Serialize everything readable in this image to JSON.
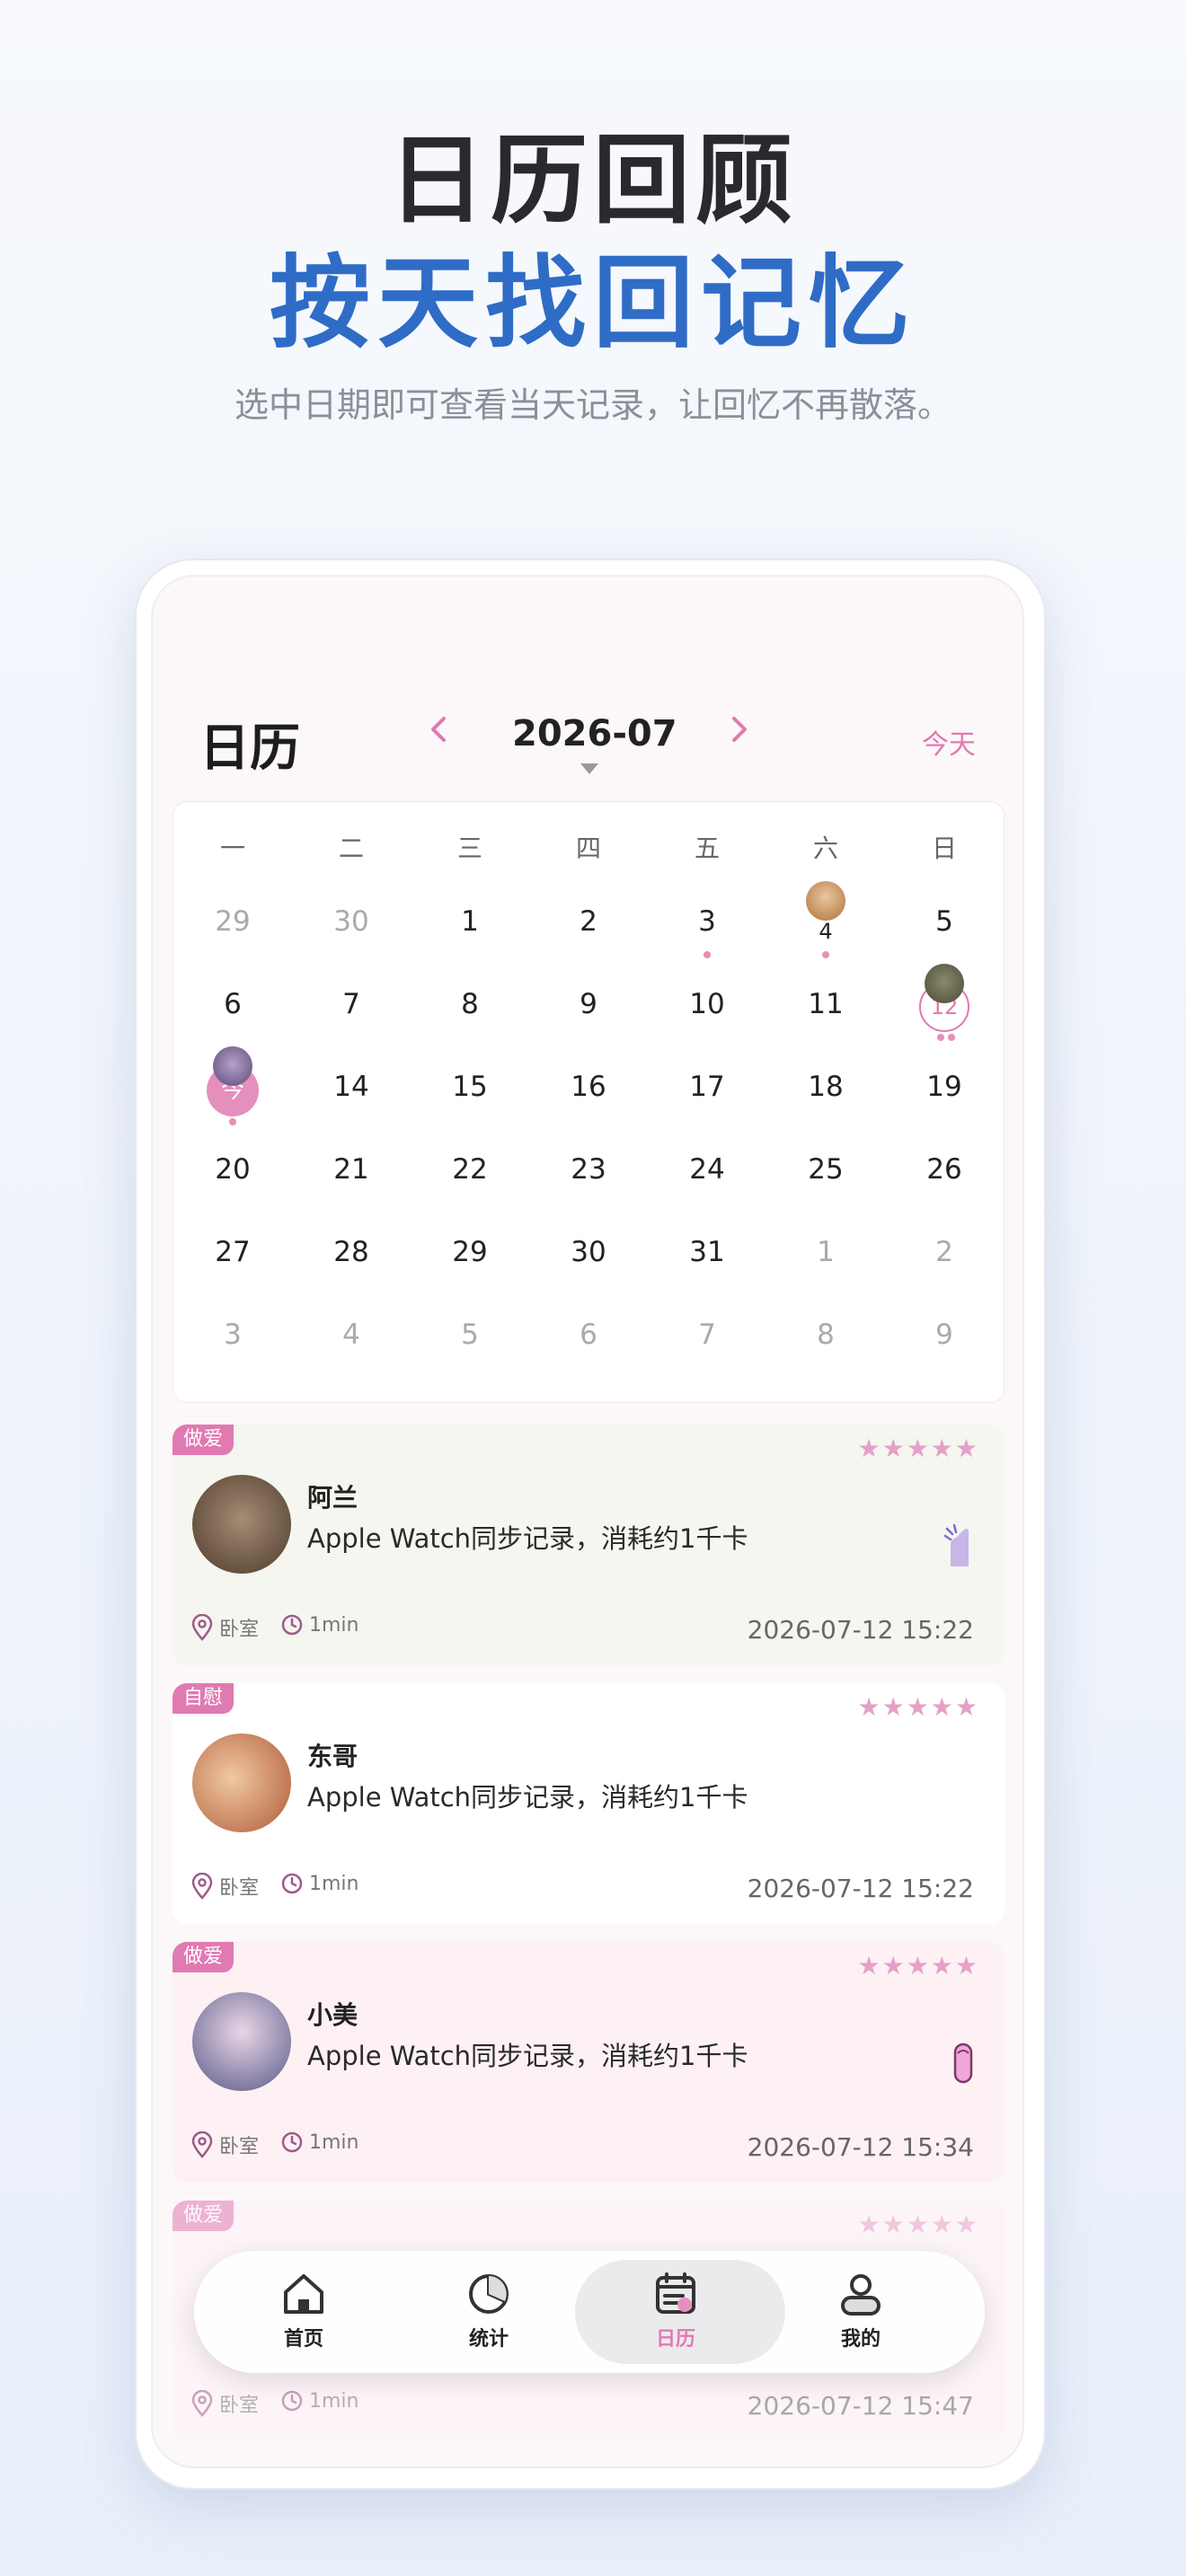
{
  "hero": {
    "title": "日历回顾",
    "subtitle_blue": "按天找回记忆",
    "caption": "选中日期即可查看当天记录，让回忆不再散落。"
  },
  "header": {
    "title": "日历",
    "month": "2026-07",
    "today_button": "今天"
  },
  "weekdays": [
    "一",
    "二",
    "三",
    "四",
    "五",
    "六",
    "日"
  ],
  "calendar": {
    "rows": [
      [
        "29",
        "30",
        "1",
        "2",
        "3",
        "4",
        "5"
      ],
      [
        "6",
        "7",
        "8",
        "9",
        "10",
        "11",
        "12"
      ],
      [
        "今",
        "14",
        "15",
        "16",
        "17",
        "18",
        "19"
      ],
      [
        "20",
        "21",
        "22",
        "23",
        "24",
        "25",
        "26"
      ],
      [
        "27",
        "28",
        "29",
        "30",
        "31",
        "1",
        "2"
      ],
      [
        "3",
        "4",
        "5",
        "6",
        "7",
        "8",
        "9"
      ]
    ]
  },
  "records": [
    {
      "tag": "做爱",
      "name": "阿兰",
      "desc": "Apple Watch同步记录，消耗约1千卡",
      "location": "卧室",
      "duration": "1min",
      "time": "2026-07-12 15:22",
      "stars": "★★★★★"
    },
    {
      "tag": "自慰",
      "name": "东哥",
      "desc": "Apple Watch同步记录，消耗约1千卡",
      "location": "卧室",
      "duration": "1min",
      "time": "2026-07-12 15:22",
      "stars": "★★★★★"
    },
    {
      "tag": "做爱",
      "name": "小美",
      "desc": "Apple Watch同步记录，消耗约1千卡",
      "location": "卧室",
      "duration": "1min",
      "time": "2026-07-12 15:34",
      "stars": "★★★★★"
    },
    {
      "tag": "做爱",
      "name": "",
      "desc": "",
      "location": "卧室",
      "duration": "1min",
      "time": "2026-07-12 15:47",
      "stars": "★★★★★"
    }
  ],
  "tabs": [
    {
      "label": "首页",
      "icon": "home-icon"
    },
    {
      "label": "统计",
      "icon": "pie-chart-icon"
    },
    {
      "label": "日历",
      "icon": "calendar-icon"
    },
    {
      "label": "我的",
      "icon": "user-icon"
    }
  ],
  "colors": {
    "accent": "#e07ab2",
    "blue": "#2f6cc6"
  }
}
